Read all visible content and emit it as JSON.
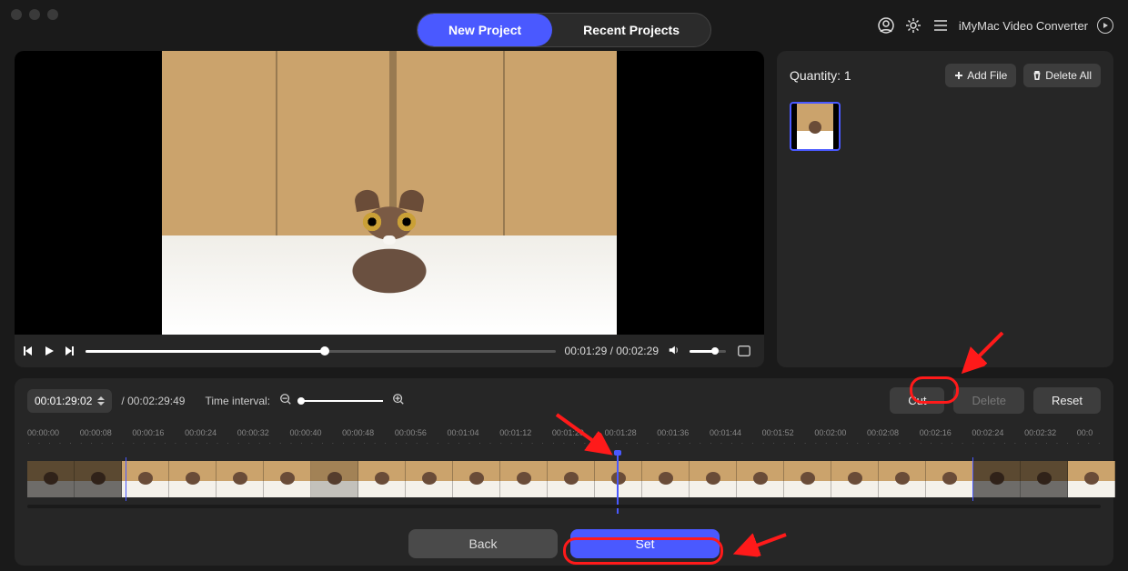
{
  "app": {
    "title": "iMyMac Video Converter"
  },
  "tabs": {
    "new": "New Project",
    "recent": "Recent Projects"
  },
  "side": {
    "quantity_label": "Quantity:",
    "quantity_value": "1",
    "add": "Add File",
    "delete_all": "Delete All"
  },
  "player": {
    "current": "00:01:29",
    "total": "00:02:29"
  },
  "editor": {
    "timecode": "00:01:29:02",
    "duration": "00:02:29:49",
    "time_interval_label": "Time interval:",
    "cut": "Cut",
    "delete": "Delete",
    "reset": "Reset",
    "back": "Back",
    "set": "Set",
    "ticks": [
      "00:00:00",
      "00:00:08",
      "00:00:16",
      "00:00:24",
      "00:00:32",
      "00:00:40",
      "00:00:48",
      "00:00:56",
      "00:01:04",
      "00:01:12",
      "00:01:20",
      "00:01:28",
      "00:01:36",
      "00:01:44",
      "00:01:52",
      "00:02:00",
      "00:02:08",
      "00:02:16",
      "00:02:24",
      "00:02:32",
      "00:0"
    ]
  }
}
